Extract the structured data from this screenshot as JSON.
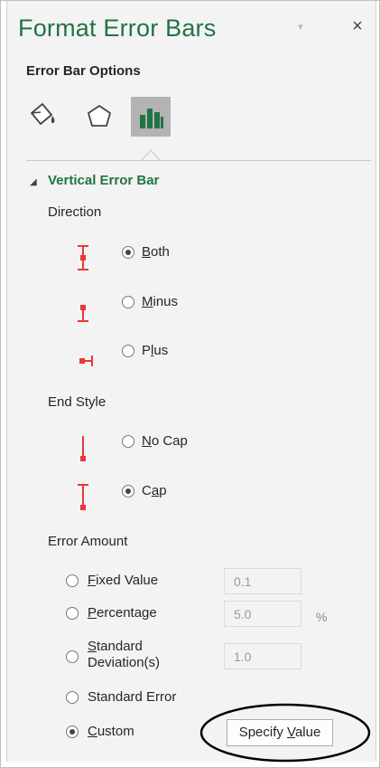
{
  "pane": {
    "title": "Format Error Bars",
    "menu_icon": "caret-down-icon",
    "close_glyph": "×"
  },
  "options_label": "Error Bar Options",
  "tabs": [
    {
      "name": "fill-line",
      "icon": "paint-bucket-icon",
      "selected": false
    },
    {
      "name": "effects",
      "icon": "pentagon-icon",
      "selected": false
    },
    {
      "name": "error-bar-options",
      "icon": "bar-chart-icon",
      "selected": true
    }
  ],
  "section": {
    "toggle_glyph": "◢",
    "title": "Vertical Error Bar"
  },
  "direction": {
    "label": "Direction",
    "options": [
      {
        "pre": "",
        "u": "B",
        "post": "oth",
        "checked": true
      },
      {
        "pre": "",
        "u": "M",
        "post": "inus",
        "checked": false
      },
      {
        "pre": "P",
        "u": "l",
        "post": "us",
        "checked": false
      }
    ]
  },
  "end_style": {
    "label": "End Style",
    "options": [
      {
        "pre": "",
        "u": "N",
        "post": "o Cap",
        "checked": false
      },
      {
        "pre": "C",
        "u": "a",
        "post": "p",
        "checked": true
      }
    ]
  },
  "error_amount": {
    "label": "Error Amount",
    "fixed": {
      "pre": "",
      "u": "F",
      "post": "ixed Value",
      "value": "0.1",
      "checked": false
    },
    "percentage": {
      "pre": "",
      "u": "P",
      "post": "ercentage",
      "value": "5.0",
      "unit": "%",
      "checked": false
    },
    "stddev": {
      "line1_u": "S",
      "line1_post": "tandard",
      "line2": "Deviation(s)",
      "value": "1.0",
      "checked": false
    },
    "stderr": {
      "label": "Standard Error",
      "checked": false
    },
    "custom": {
      "pre": "",
      "u": "C",
      "post": "ustom",
      "checked": true
    },
    "specify_button": {
      "pre": "Specify ",
      "u": "V",
      "post": "alue"
    }
  },
  "colors": {
    "accent": "#217346",
    "error_bar_red": "#e8363a"
  }
}
